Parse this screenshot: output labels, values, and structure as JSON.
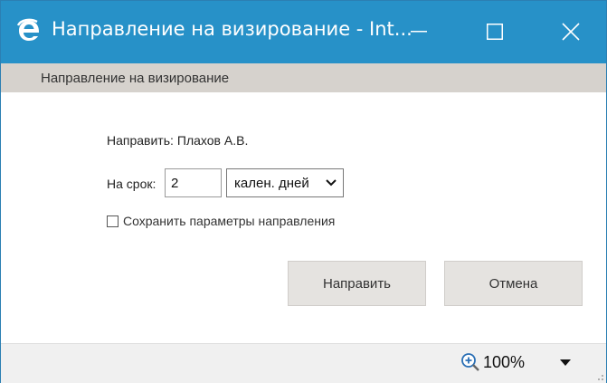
{
  "window": {
    "title": "Направление на визирование - Int...",
    "icon": "ie-icon",
    "controls": [
      "minimize-icon",
      "maximize-icon",
      "close-icon"
    ]
  },
  "subheader": {
    "text": "Направление на визирование"
  },
  "form": {
    "direct_label": "Направить:",
    "direct_value": "Плахов А.В.",
    "term_label": "На срок:",
    "term_value": "2",
    "unit_selected": "кален. дней",
    "save_params_label": "Сохранить параметры направления",
    "save_params_checked": false
  },
  "buttons": {
    "submit": "Направить",
    "cancel": "Отмена"
  },
  "statusbar": {
    "zoom": "100%"
  },
  "colors": {
    "titlebar": "#2791c8",
    "subheader": "#d6d2cd",
    "button": "#e5e3e0"
  }
}
